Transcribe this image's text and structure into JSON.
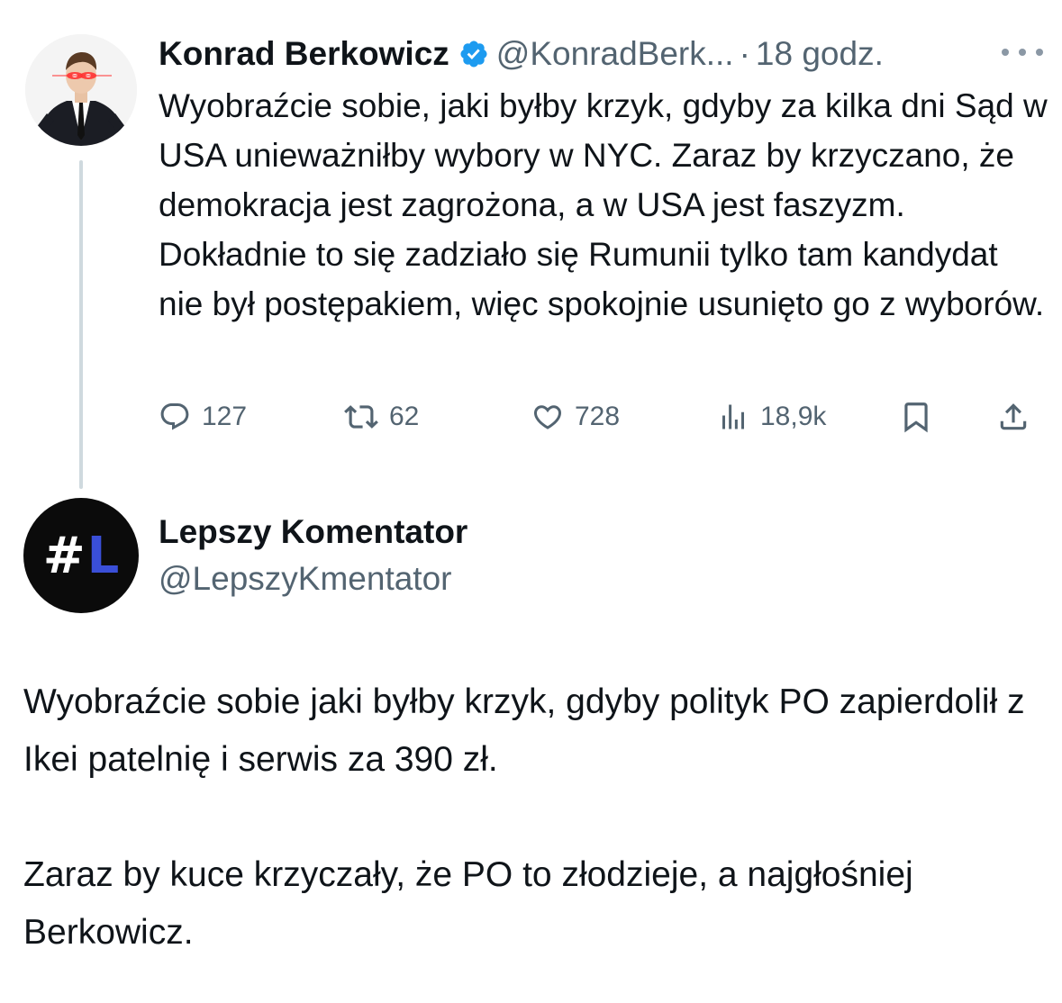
{
  "tweet": {
    "author_name": "Konrad Berkowicz",
    "author_handle": "@KonradBerk...",
    "separator": "·",
    "time": "18 godz.",
    "text": "Wyobraźcie sobie, jaki byłby krzyk, gdyby za kilka dni Sąd w USA unieważniłby wybory w NYC. Zaraz by krzyczano, że demokracja jest zagrożona, a w USA jest faszyzm. Dokładnie to się zadziało się Rumunii tylko tam kandydat nie był postępakiem, więc spokojnie usunięto go z wyborów.",
    "stats": {
      "replies": "127",
      "retweets": "62",
      "likes": "728",
      "views": "18,9k"
    },
    "icons": [
      "verified-badge-icon",
      "more-icon",
      "reply-icon",
      "retweet-icon",
      "like-icon",
      "views-icon",
      "bookmark-icon",
      "share-icon"
    ]
  },
  "reply": {
    "avatar_text_hash": "#",
    "avatar_text_letter": "L",
    "author_name": "Lepszy Komentator",
    "author_handle": "@LepszyKmentator",
    "paragraph_1": "Wyobraźcie sobie jaki byłby krzyk, gdyby polityk PO zapierdolił z Ikei patelnię i serwis za 390 zł.",
    "paragraph_2": "Zaraz by kuce krzyczały, że PO to złodzieje, a najgłośniej Berkowicz."
  },
  "colors": {
    "text": "#0f1419",
    "secondary": "#536471",
    "verified": "#1d9bf0",
    "thread_line": "#cfd9de",
    "avatar_accent": "#3a4fd8"
  }
}
